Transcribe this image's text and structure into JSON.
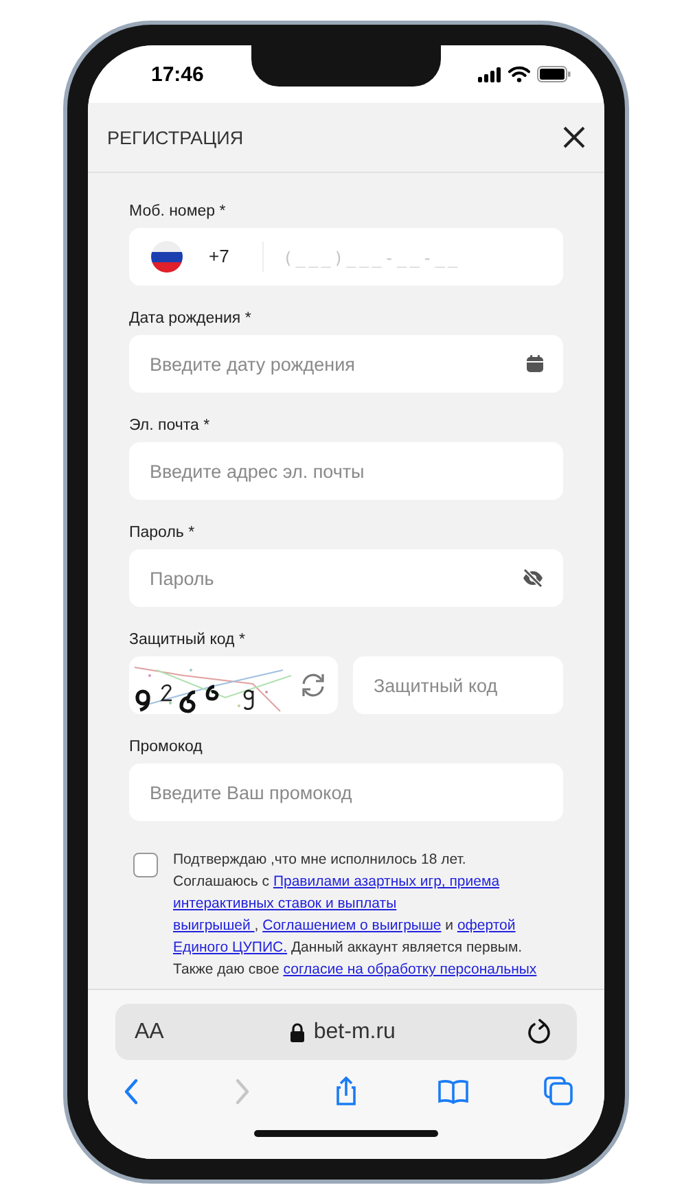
{
  "status_bar": {
    "time": "17:46"
  },
  "header": {
    "title": "РЕГИСТРАЦИЯ"
  },
  "fields": [
    {
      "kind": "phone",
      "label": "Моб. номер *",
      "country_code": "+7",
      "placeholder": "(___)___-__-__"
    },
    {
      "kind": "date",
      "label": "Дата рождения *",
      "placeholder": "Введите дату рождения"
    },
    {
      "kind": "email",
      "label": "Эл. почта *",
      "placeholder": "Введите адрес эл. почты"
    },
    {
      "kind": "password",
      "label": "Пароль *",
      "placeholder": "Пароль"
    },
    {
      "kind": "captcha",
      "label": "Защитный код *",
      "placeholder": "Защитный код"
    },
    {
      "kind": "promo",
      "label": "Промокод",
      "placeholder": "Введите Ваш промокод"
    }
  ],
  "consent": {
    "checked": false,
    "lines": [
      [
        {
          "text": "Подтверждаю ,что мне исполнилось 18 лет.",
          "link": false
        }
      ],
      [
        {
          "text": "Соглашаюсь с ",
          "link": false
        },
        {
          "text": "Правилами азартных игр, приема",
          "link": true
        }
      ],
      [
        {
          "text": "интерактивных ставок и выплаты",
          "link": true
        }
      ],
      [
        {
          "text": "выигрышей ",
          "link": true
        },
        {
          "text": ", ",
          "link": false
        },
        {
          "text": "Соглашением о выигрыше",
          "link": true
        },
        {
          "text": "  и ",
          "link": false
        },
        {
          "text": "офертой",
          "link": true
        }
      ],
      [
        {
          "text": "Единого ЦУПИС.",
          "link": true
        },
        {
          "text": " Данный аккаунт является первым.",
          "link": false
        }
      ],
      [
        {
          "text": "Также даю свое ",
          "link": false
        },
        {
          "text": "согласие на обработку персональных",
          "link": true
        }
      ]
    ]
  },
  "browser": {
    "text_size_button": "AA",
    "url": "bet-m.ru",
    "nav": [
      {
        "kind": "back",
        "disabled": false
      },
      {
        "kind": "forward",
        "disabled": true
      },
      {
        "kind": "share",
        "disabled": false
      },
      {
        "kind": "bookmarks",
        "disabled": false
      },
      {
        "kind": "tabs",
        "disabled": false
      }
    ]
  }
}
